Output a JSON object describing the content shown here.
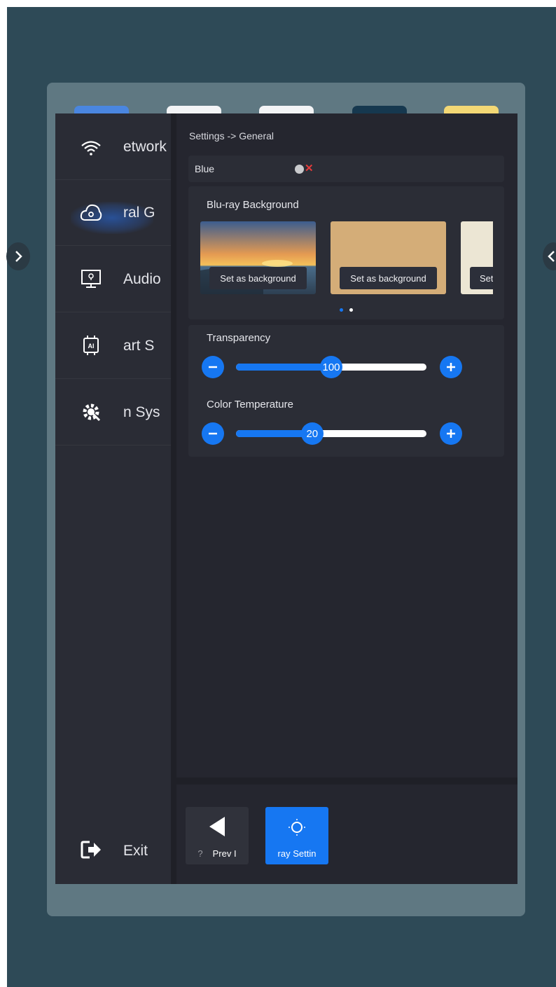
{
  "sidebar": {
    "items": [
      {
        "label": "etwork",
        "icon": "wifi-icon"
      },
      {
        "label": "ral  G",
        "icon": "cloud-settings-icon",
        "active": true
      },
      {
        "label": "Audio",
        "icon": "monitor-icon"
      },
      {
        "label": "art  S",
        "icon": "ai-chip-icon"
      },
      {
        "label": "n  Sys",
        "icon": "gear-wrench-icon"
      }
    ],
    "exit_label": "Exit",
    "exit_icon": "exit-icon"
  },
  "main": {
    "breadcrumb": "Settings -> General",
    "blue_row": {
      "label": "Blue"
    },
    "background_card": {
      "title": "Blu-ray Background",
      "thumbnails": [
        {
          "button_label": "Set as background",
          "image": "sunset-sea"
        },
        {
          "button_label": "Set as background",
          "image": "sand-texture"
        },
        {
          "button_label": "Set",
          "image": "cream-texture"
        }
      ],
      "page_dots": 2,
      "current_page": 1
    },
    "sliders": [
      {
        "label": "Transparency",
        "value": "100",
        "fraction": 0.5
      },
      {
        "label": "Color Temperature",
        "value": "20",
        "fraction": 0.4
      }
    ]
  },
  "bottom_bar": {
    "prev_button": {
      "label": "Prev I",
      "prefix": "?",
      "icon": "triangle-left-icon"
    },
    "settings_button": {
      "label": "ray Settin",
      "icon": "sun-icon"
    }
  },
  "colors": {
    "accent": "#1677f2",
    "panel": "#25262f",
    "sidebar": "#2a2c35",
    "frame": "#5f7882",
    "backdrop": "#2e4a57"
  }
}
